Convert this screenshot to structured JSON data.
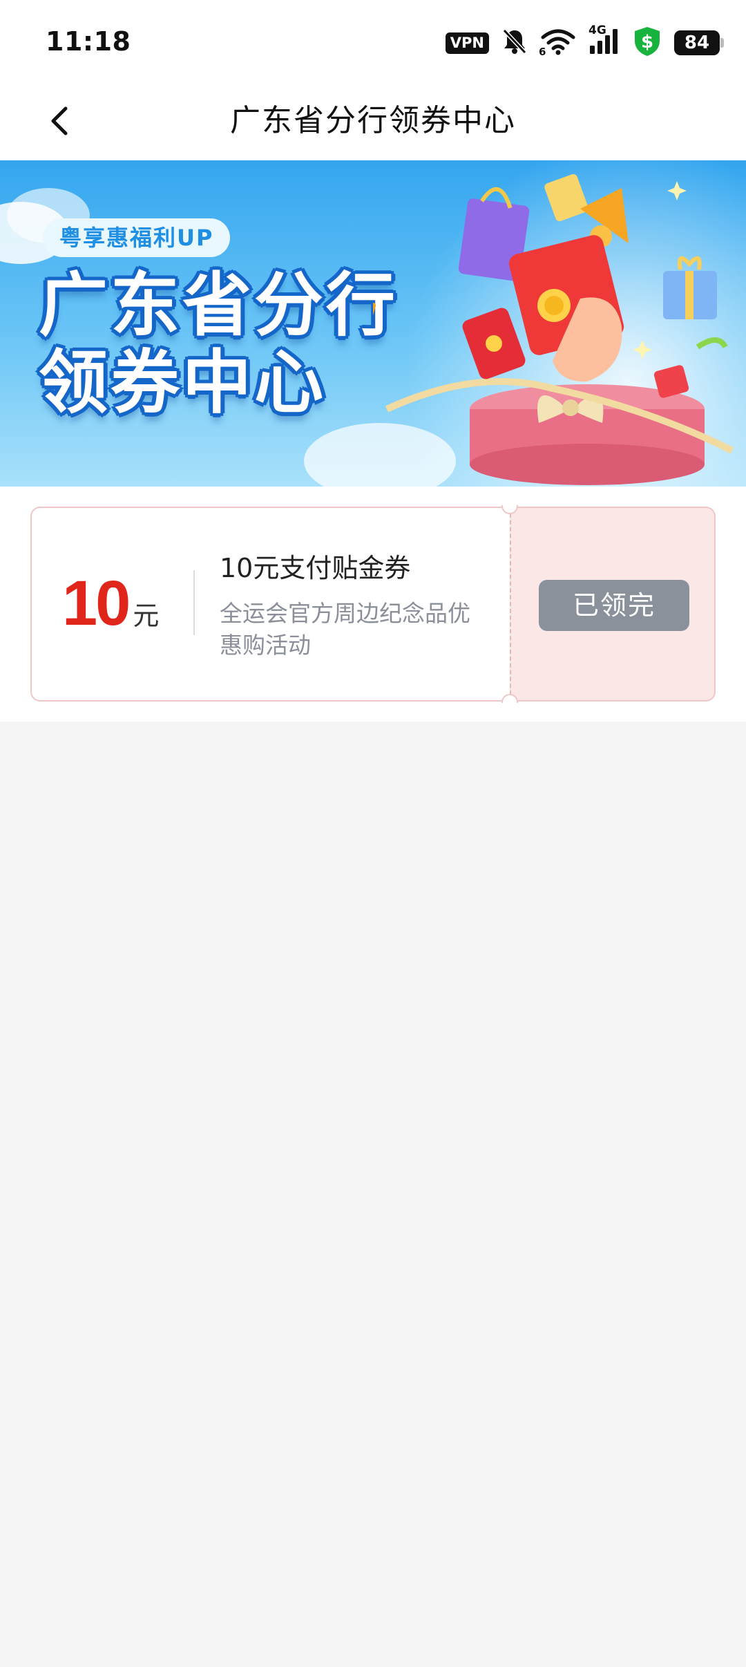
{
  "status_bar": {
    "time": "11:18",
    "vpn_label": "VPN",
    "network_label": "4G",
    "wifi_label": "6",
    "battery": "84",
    "icons": [
      "vpn-icon",
      "bell-off-icon",
      "wifi-icon",
      "signal-icon",
      "shield-dollar-icon",
      "battery-icon"
    ]
  },
  "nav": {
    "back_icon": "chevron-left-icon",
    "title": "广东省分行领券中心"
  },
  "banner": {
    "tag": "粤享惠福利UP",
    "headline_line1": "广东省分行",
    "headline_line2": "领券中心"
  },
  "coupon": {
    "amount": "10",
    "unit": "元",
    "title": "10元支付贴金券",
    "description": "全运会官方周边纪念品优惠购活动",
    "button_label": "已领完",
    "button_color": "#8b919b",
    "accent_color": "#e0251b"
  }
}
